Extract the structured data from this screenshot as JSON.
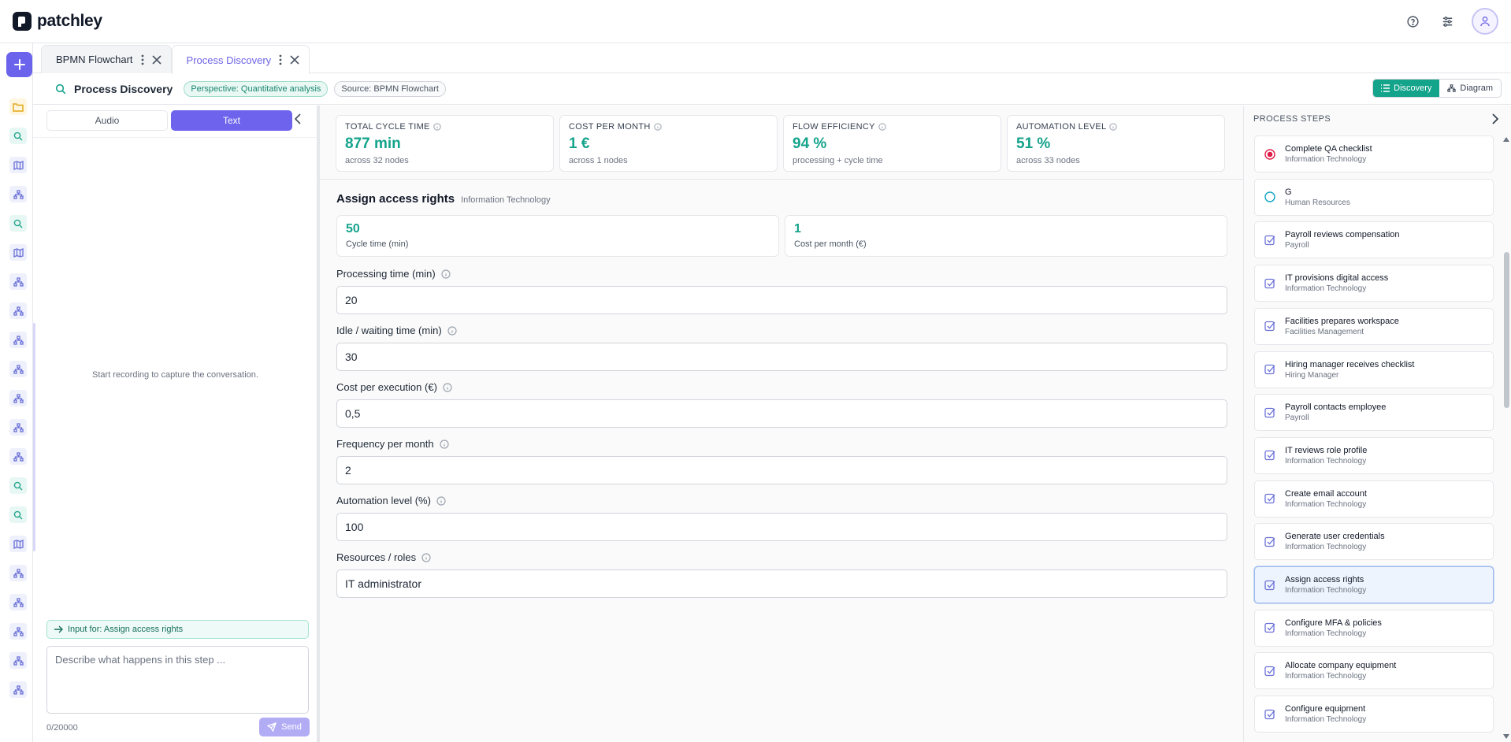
{
  "app": {
    "name": "patchley"
  },
  "tabs": [
    {
      "label": "BPMN Flowchart"
    },
    {
      "label": "Process Discovery"
    }
  ],
  "subheader": {
    "title": "Process Discovery",
    "perspective": "Perspective: Quantitative analysis",
    "source": "Source: BPMN Flowchart",
    "view_discovery": "Discovery",
    "view_diagram": "Diagram"
  },
  "left_panel": {
    "audio_label": "Audio",
    "text_label": "Text",
    "empty_message": "Start recording to capture the conversation.",
    "input_for": "Input for: Assign access rights",
    "placeholder": "Describe what happens in this step ...",
    "char_count": "0/20000",
    "send_label": "Send"
  },
  "kpis": [
    {
      "label": "TOTAL CYCLE TIME",
      "value": "877 min",
      "sub": "across 32 nodes"
    },
    {
      "label": "COST PER MONTH",
      "value": "1 €",
      "sub": "across 1 nodes"
    },
    {
      "label": "FLOW EFFICIENCY",
      "value": "94 %",
      "sub": "processing + cycle time"
    },
    {
      "label": "AUTOMATION LEVEL",
      "value": "51 %",
      "sub": "across 33 nodes"
    }
  ],
  "step": {
    "title": "Assign access rights",
    "department": "Information Technology",
    "cycle_time": "50",
    "cycle_time_label": "Cycle time (min)",
    "cost_per_month": "1",
    "cost_per_month_label": "Cost per month (€)",
    "fields": [
      {
        "label": "Processing time (min)",
        "value": "20"
      },
      {
        "label": "Idle / waiting time (min)",
        "value": "30"
      },
      {
        "label": "Cost per execution (€)",
        "value": "0,5"
      },
      {
        "label": "Frequency per month",
        "value": "2"
      },
      {
        "label": "Automation level (%)",
        "value": "100"
      },
      {
        "label": "Resources / roles",
        "value": "IT administrator"
      }
    ]
  },
  "process_steps": {
    "heading": "PROCESS STEPS",
    "items": [
      {
        "name": "Complete QA checklist",
        "dept": "Information Technology",
        "type": "end"
      },
      {
        "name": "G",
        "dept": "Human Resources",
        "type": "start"
      },
      {
        "name": "Payroll reviews compensation",
        "dept": "Payroll",
        "type": "task"
      },
      {
        "name": "IT provisions digital access",
        "dept": "Information Technology",
        "type": "task"
      },
      {
        "name": "Facilities prepares workspace",
        "dept": "Facilities Management",
        "type": "task"
      },
      {
        "name": "Hiring manager receives checklist",
        "dept": "Hiring Manager",
        "type": "task"
      },
      {
        "name": "Payroll contacts employee",
        "dept": "Payroll",
        "type": "task"
      },
      {
        "name": "IT reviews role profile",
        "dept": "Information Technology",
        "type": "task"
      },
      {
        "name": "Create email account",
        "dept": "Information Technology",
        "type": "task"
      },
      {
        "name": "Generate user credentials",
        "dept": "Information Technology",
        "type": "task"
      },
      {
        "name": "Assign access rights",
        "dept": "Information Technology",
        "type": "task",
        "selected": true
      },
      {
        "name": "Configure MFA & policies",
        "dept": "Information Technology",
        "type": "task"
      },
      {
        "name": "Allocate company equipment",
        "dept": "Information Technology",
        "type": "task"
      },
      {
        "name": "Configure equipment",
        "dept": "Information Technology",
        "type": "task"
      }
    ]
  },
  "colors": {
    "accent": "#6d63ec",
    "teal": "#14a38b"
  }
}
